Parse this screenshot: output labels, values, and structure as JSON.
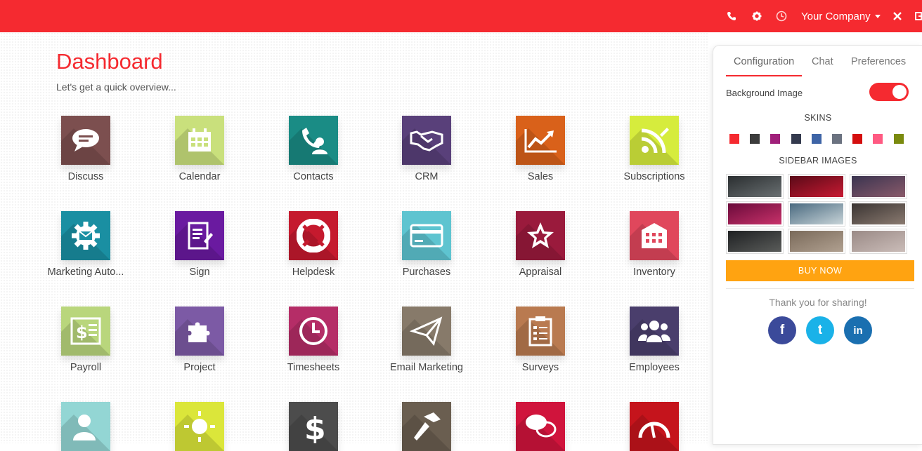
{
  "navbar": {
    "background": "#f52a30",
    "company": "Your Company",
    "icons": [
      "phone-icon",
      "gear-icon",
      "clock-icon",
      "close-icon",
      "logout-icon"
    ]
  },
  "dashboard": {
    "title": "Dashboard",
    "subtitle": "Let's get a quick overview..."
  },
  "apps": [
    {
      "label": "Discuss",
      "color": "#7c4f4f",
      "icon": "chat-bubble-icon"
    },
    {
      "label": "Calendar",
      "color": "#c9e07c",
      "icon": "calendar-icon"
    },
    {
      "label": "Contacts",
      "color": "#1a8c85",
      "icon": "contacts-icon"
    },
    {
      "label": "CRM",
      "color": "#59407a",
      "icon": "handshake-icon"
    },
    {
      "label": "Sales",
      "color": "#d9611a",
      "icon": "trend-chart-icon"
    },
    {
      "label": "Subscriptions",
      "color": "#d6ec3d",
      "icon": "rss-icon"
    },
    {
      "label": "Marketing Auto...",
      "color": "#1a8fa2",
      "icon": "gear-mail-icon"
    },
    {
      "label": "Sign",
      "color": "#6a1aa0",
      "icon": "sign-document-icon"
    },
    {
      "label": "Helpdesk",
      "color": "#c51a2e",
      "icon": "lifebuoy-icon"
    },
    {
      "label": "Purchases",
      "color": "#5ec4d0",
      "icon": "credit-card-icon"
    },
    {
      "label": "Appraisal",
      "color": "#9a1a3c",
      "icon": "star-icon"
    },
    {
      "label": "Inventory",
      "color": "#e0475c",
      "icon": "warehouse-icon"
    },
    {
      "label": "Payroll",
      "color": "#b9d67c",
      "icon": "payroll-icon"
    },
    {
      "label": "Project",
      "color": "#7c5aa5",
      "icon": "puzzle-icon"
    },
    {
      "label": "Timesheets",
      "color": "#b52d67",
      "icon": "clock-icon"
    },
    {
      "label": "Email Marketing",
      "color": "#877a6a",
      "icon": "paper-plane-icon"
    },
    {
      "label": "Surveys",
      "color": "#b97a50",
      "icon": "clipboard-icon"
    },
    {
      "label": "Employees",
      "color": "#4a3e6c",
      "icon": "people-icon"
    },
    {
      "label": "",
      "color": "#93d6d4",
      "icon": "user-check-icon"
    },
    {
      "label": "",
      "color": "#dbe63a",
      "icon": "sun-icon"
    },
    {
      "label": "",
      "color": "#4c4c4c",
      "icon": "dollar-icon"
    },
    {
      "label": "",
      "color": "#6a5e50",
      "icon": "hammer-icon"
    },
    {
      "label": "",
      "color": "#d0143c",
      "icon": "comments-icon"
    },
    {
      "label": "",
      "color": "#c5141c",
      "icon": "dashboard-gauge-icon"
    }
  ],
  "panel": {
    "tabs": [
      "Configuration",
      "Chat",
      "Preferences"
    ],
    "active_tab": "Configuration",
    "background_image_label": "Background Image",
    "background_image_enabled": true,
    "skins_title": "SKINS",
    "skins": [
      "#f52a30",
      "#3c3c3c",
      "#a0207a",
      "#343a4e",
      "#3e64a6",
      "#6b7280",
      "#d40e0e",
      "#ff5a82",
      "#7a8a0e"
    ],
    "sidebar_images_title": "SIDEBAR IMAGES",
    "sidebar_images": [
      {
        "from": "#2a2e30",
        "to": "#6a7072"
      },
      {
        "from": "#5a0a18",
        "to": "#c81a32"
      },
      {
        "from": "#3a3450",
        "to": "#8a5a6a"
      },
      {
        "from": "#6a0a3a",
        "to": "#c8326a"
      },
      {
        "from": "#4a6a80",
        "to": "#c8d4d8"
      },
      {
        "from": "#3a3432",
        "to": "#8a7a70"
      },
      {
        "from": "#1e2022",
        "to": "#5a5c5a"
      },
      {
        "from": "#7a6a5a",
        "to": "#b0a090"
      },
      {
        "from": "#9a8a86",
        "to": "#cabcb8"
      }
    ],
    "buy_label": "BUY NOW",
    "thanks": "Thank you for sharing!",
    "social": [
      {
        "name": "facebook",
        "glyph": "f",
        "color": "#3b4a9a"
      },
      {
        "name": "twitter",
        "glyph": "t",
        "color": "#1ab2e8"
      },
      {
        "name": "linkedin",
        "glyph": "in",
        "color": "#1a6fb0"
      }
    ]
  }
}
